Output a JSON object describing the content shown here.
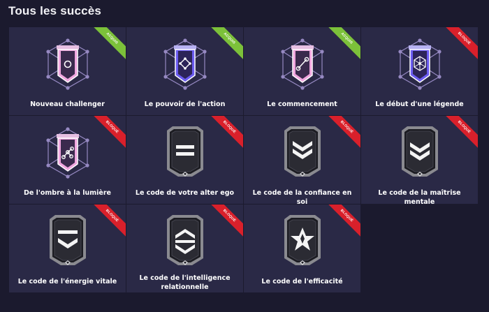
{
  "page_title": "Tous les succès",
  "achievements": [
    {
      "name": "Nouveau challenger",
      "status": "Acquis",
      "icon": "banner-circle-icon",
      "unlocked": true
    },
    {
      "name": "Le pouvoir de l'action",
      "status": "Acquis",
      "icon": "banner-diamond-icon",
      "unlocked": true
    },
    {
      "name": "Le commencement",
      "status": "Acquis",
      "icon": "banner-line-icon",
      "unlocked": true
    },
    {
      "name": "Le début d'une légende",
      "status": "Bloqué",
      "icon": "banner-hexnet-icon",
      "unlocked": false
    },
    {
      "name": "De l'ombre à la lumière",
      "status": "Bloqué",
      "icon": "banner-nodes-icon",
      "unlocked": false
    },
    {
      "name": "Le code de votre alter ego",
      "status": "Bloqué",
      "icon": "shield-bars-icon",
      "unlocked": false
    },
    {
      "name": "Le code de la confiance en soi",
      "status": "Bloqué",
      "icon": "shield-double-chevron-icon",
      "unlocked": false
    },
    {
      "name": "Le code de la maîtrise mentale",
      "status": "Bloqué",
      "icon": "shield-chevron-icon",
      "unlocked": false
    },
    {
      "name": "Le code de l'énergie vitale",
      "status": "Bloqué",
      "icon": "shield-bar-chevron-icon",
      "unlocked": false
    },
    {
      "name": "Le code de l'intelligence relationnelle",
      "status": "Bloqué",
      "icon": "shield-hex-icon",
      "unlocked": false
    },
    {
      "name": "Le code de l'efficacité",
      "status": "Bloqué",
      "icon": "shield-star-icon",
      "unlocked": false
    }
  ],
  "colors": {
    "background": "#1b1a2e",
    "card": "#2a2946",
    "acquired_ribbon": "#7cc13a",
    "locked_ribbon": "#d9202b",
    "banner_pink": "#f0a6df",
    "banner_purple": "#6b5cf0",
    "shield_gray": "#8a8a90"
  }
}
